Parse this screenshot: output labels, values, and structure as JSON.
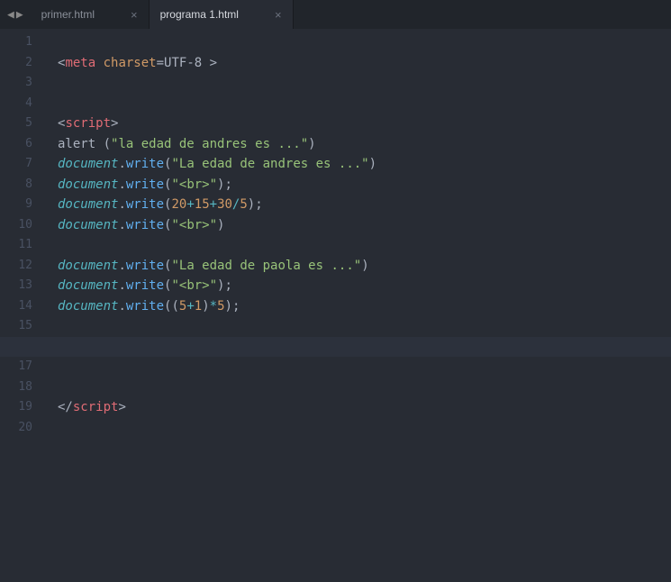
{
  "nav": {
    "prev_glyph": "◀",
    "next_glyph": "▶"
  },
  "tabs": [
    {
      "label": "primer.html",
      "active": false,
      "close": "×"
    },
    {
      "label": "programa 1.html",
      "active": true,
      "close": "×"
    }
  ],
  "editor": {
    "active_line": 16,
    "total_lines": 20,
    "lines": {
      "1": [],
      "2": [
        {
          "t": "<",
          "c": "punct"
        },
        {
          "t": "meta",
          "c": "tag"
        },
        {
          "t": " ",
          "c": "default"
        },
        {
          "t": "charset",
          "c": "attr"
        },
        {
          "t": "=UTF-8 ",
          "c": "default"
        },
        {
          "t": ">",
          "c": "punct"
        }
      ],
      "3": [],
      "4": [],
      "5": [
        {
          "t": "<",
          "c": "punct"
        },
        {
          "t": "script",
          "c": "tag"
        },
        {
          "t": ">",
          "c": "punct"
        }
      ],
      "6": [
        {
          "t": "alert (",
          "c": "default"
        },
        {
          "t": "\"la edad de andres es ...\"",
          "c": "string"
        },
        {
          "t": ")",
          "c": "default"
        }
      ],
      "7": [
        {
          "t": "document",
          "c": "italic"
        },
        {
          "t": ".",
          "c": "punct"
        },
        {
          "t": "write",
          "c": "func"
        },
        {
          "t": "(",
          "c": "default"
        },
        {
          "t": "\"La edad de andres es ...\"",
          "c": "string"
        },
        {
          "t": ")",
          "c": "default"
        }
      ],
      "8": [
        {
          "t": "document",
          "c": "italic"
        },
        {
          "t": ".",
          "c": "punct"
        },
        {
          "t": "write",
          "c": "func"
        },
        {
          "t": "(",
          "c": "default"
        },
        {
          "t": "\"<br>\"",
          "c": "string"
        },
        {
          "t": ");",
          "c": "default"
        }
      ],
      "9": [
        {
          "t": "document",
          "c": "italic"
        },
        {
          "t": ".",
          "c": "punct"
        },
        {
          "t": "write",
          "c": "func"
        },
        {
          "t": "(",
          "c": "default"
        },
        {
          "t": "20",
          "c": "num"
        },
        {
          "t": "+",
          "c": "op"
        },
        {
          "t": "15",
          "c": "num"
        },
        {
          "t": "+",
          "c": "op"
        },
        {
          "t": "30",
          "c": "num"
        },
        {
          "t": "/",
          "c": "op"
        },
        {
          "t": "5",
          "c": "num"
        },
        {
          "t": ");",
          "c": "default"
        }
      ],
      "10": [
        {
          "t": "document",
          "c": "italic"
        },
        {
          "t": ".",
          "c": "punct"
        },
        {
          "t": "write",
          "c": "func"
        },
        {
          "t": "(",
          "c": "default"
        },
        {
          "t": "\"<br>\"",
          "c": "string"
        },
        {
          "t": ")",
          "c": "default"
        }
      ],
      "11": [],
      "12": [
        {
          "t": "document",
          "c": "italic"
        },
        {
          "t": ".",
          "c": "punct"
        },
        {
          "t": "write",
          "c": "func"
        },
        {
          "t": "(",
          "c": "default"
        },
        {
          "t": "\"La edad de paola es ...\"",
          "c": "string"
        },
        {
          "t": ")",
          "c": "default"
        }
      ],
      "13": [
        {
          "t": "document",
          "c": "italic"
        },
        {
          "t": ".",
          "c": "punct"
        },
        {
          "t": "write",
          "c": "func"
        },
        {
          "t": "(",
          "c": "default"
        },
        {
          "t": "\"<br>\"",
          "c": "string"
        },
        {
          "t": ");",
          "c": "default"
        }
      ],
      "14": [
        {
          "t": "document",
          "c": "italic"
        },
        {
          "t": ".",
          "c": "punct"
        },
        {
          "t": "write",
          "c": "func"
        },
        {
          "t": "((",
          "c": "default"
        },
        {
          "t": "5",
          "c": "num"
        },
        {
          "t": "+",
          "c": "op"
        },
        {
          "t": "1",
          "c": "num"
        },
        {
          "t": ")",
          "c": "default"
        },
        {
          "t": "*",
          "c": "op"
        },
        {
          "t": "5",
          "c": "num"
        },
        {
          "t": ");",
          "c": "default"
        }
      ],
      "15": [],
      "16": [],
      "17": [],
      "18": [],
      "19": [
        {
          "t": "</",
          "c": "punct"
        },
        {
          "t": "script",
          "c": "tag"
        },
        {
          "t": ">",
          "c": "punct"
        }
      ],
      "20": []
    }
  }
}
